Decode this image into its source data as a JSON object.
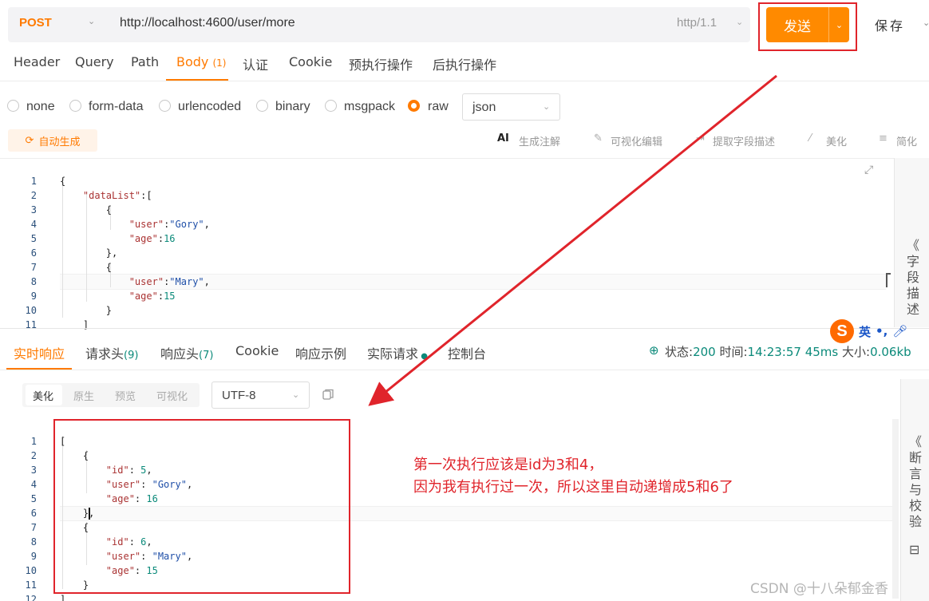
{
  "request": {
    "method": "POST",
    "url": "http://localhost:4600/user/more",
    "protocol": "http/1.1",
    "send_label": "发送",
    "save_label": "保存"
  },
  "request_tabs": [
    {
      "label": "Header"
    },
    {
      "label": "Query"
    },
    {
      "label": "Path"
    },
    {
      "label": "Body",
      "count": "(1)"
    },
    {
      "label": "认证"
    },
    {
      "label": "Cookie"
    },
    {
      "label": "预执行操作"
    },
    {
      "label": "后执行操作"
    }
  ],
  "body_types": [
    "none",
    "form-data",
    "urlencoded",
    "binary",
    "msgpack",
    "raw"
  ],
  "body_type_selected": "raw",
  "raw_format": "json",
  "tools": {
    "autogen": "自动生成",
    "ai_comment": "生成注解",
    "visual_edit": "可视化编辑",
    "extract_desc": "提取字段描述",
    "beautify": "美化",
    "simplify": "简化"
  },
  "request_side_label": [
    "《",
    "字",
    "段",
    "描",
    "述"
  ],
  "request_body_lines": [
    "1",
    "2",
    "3",
    "4",
    "5",
    "6",
    "7",
    "8",
    "9",
    "10",
    "11"
  ],
  "request_body": {
    "l1": "{",
    "l2_key": "\"dataList\"",
    "l2_rest": ":[",
    "l3": "{",
    "l4_key": "\"user\"",
    "l4_val": "\"Gory\"",
    "l5_key": "\"age\"",
    "l5_val": "16",
    "l6": "},",
    "l7": "{",
    "l8_key": "\"user\"",
    "l8_val": "\"Mary\"",
    "l9_key": "\"age\"",
    "l9_val": "15",
    "l10": "}",
    "l11": "]"
  },
  "response_tabs": [
    {
      "label": "实时响应"
    },
    {
      "label": "请求头",
      "count": "(9)"
    },
    {
      "label": "响应头",
      "count": "(7)"
    },
    {
      "label": "Cookie"
    },
    {
      "label": "响应示例"
    },
    {
      "label": "实际请求"
    },
    {
      "label": "控制台"
    }
  ],
  "response_status": {
    "status_label": "状态:",
    "status_value": "200",
    "time_label": "时间:",
    "time_value": "14:23:57",
    "duration": "45ms",
    "size_label": "大小:",
    "size_value": "0.06kb"
  },
  "ime": {
    "label": "英"
  },
  "response_formats": [
    "美化",
    "原生",
    "预览",
    "可视化"
  ],
  "response_format_selected": "美化",
  "encoding": "UTF-8",
  "response_side_label": [
    "《",
    "断",
    "言",
    "与",
    "校",
    "验"
  ],
  "response_lines": [
    "1",
    "2",
    "3",
    "4",
    "5",
    "6",
    "7",
    "8",
    "9",
    "10",
    "11",
    "12"
  ],
  "response_body": {
    "l1": "[",
    "l2": "{",
    "l3_key": "\"id\"",
    "l3_val": "5",
    "l4_key": "\"user\"",
    "l4_val": "\"Gory\"",
    "l5_key": "\"age\"",
    "l5_val": "16",
    "l6": "},",
    "l7": "{",
    "l8_key": "\"id\"",
    "l8_val": "6",
    "l9_key": "\"user\"",
    "l9_val": "\"Mary\"",
    "l10_key": "\"age\"",
    "l10_val": "15",
    "l11": "}",
    "l12": "]"
  },
  "annotation": {
    "line1": "第一次执行应该是id为3和4，",
    "line2": "因为我有执行过一次，所以这里自动递增成5和6了"
  },
  "watermark": "CSDN @十八朵郁金香",
  "colors": {
    "accent": "#ff7a00",
    "annotation": "#e0242b",
    "status_ok": "#0b8a7a"
  }
}
